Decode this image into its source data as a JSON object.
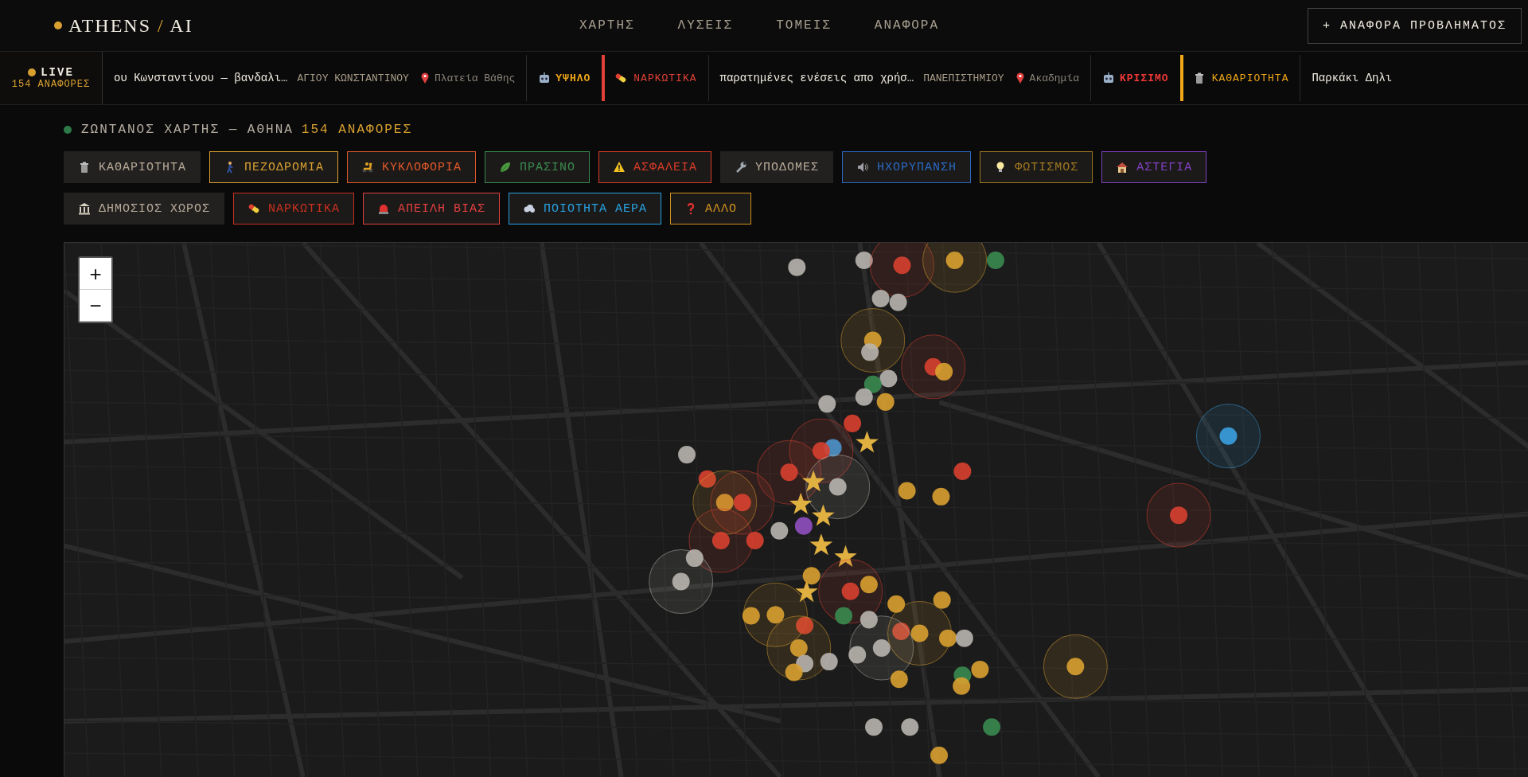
{
  "header": {
    "logo": {
      "name": "ATHENS",
      "separator": "/",
      "suffix": "AI"
    },
    "nav": [
      {
        "label": "ΧΑΡΤΗΣ",
        "selected": false
      },
      {
        "label": "ΛΥΣΕΙΣ",
        "selected": false
      },
      {
        "label": "ΤΟΜΕΙΣ",
        "selected": false
      },
      {
        "label": "ΑΝΑΦΟΡΑ",
        "selected": false
      }
    ],
    "report_button": "+ ΑΝΑΦΟΡΑ ΠΡΟΒΛΗΜΑΤΟΣ"
  },
  "ticker": {
    "live_label": "LIVE",
    "live_count": "154 ΑΝΑΦΟΡΕΣ",
    "items": [
      {
        "title": "ου Κωνσταντίνου — βανδαλι…",
        "street": "ΑΓΙΟΥ ΚΩΝΣΤΑΝΤΙΝΟΥ",
        "place": "Πλατεία Βάθης",
        "priority": {
          "label": "ΥΨΗΛΟ",
          "color": "#f0a818"
        }
      },
      {
        "category": {
          "label": "ΝΑΡΚΩΤΙΚΑ",
          "color": "#e04038"
        },
        "title": "παρατημένες ενέσεις απο χρήσ…",
        "street": "ΠΑΝΕΠΙΣΤΗΜΙΟΥ",
        "place": "Ακαδημία",
        "priority": {
          "label": "ΚΡΙΣΙΜΟ",
          "color": "#f03838"
        }
      },
      {
        "category": {
          "label": "ΚΑΘΑΡΙΟΤΗΤΑ",
          "color": "#f0a818"
        },
        "title": "Παρκάκι Δηλι"
      }
    ]
  },
  "section": {
    "title": "ΖΩΝΤΑΝΟΣ ΧΑΡΤΗΣ — ΑΘΗΝΑ",
    "count": "154 ΑΝΑΦΟΡΕΣ"
  },
  "filters": [
    {
      "label": "ΚΑΘΑΡΙΟΤΗΤΑ",
      "kind": "filled",
      "color": "#b8aa98"
    },
    {
      "label": "ΠΕΖΟΔΡΟΜΙΑ",
      "kind": "outlined",
      "color": "#d9a030"
    },
    {
      "label": "ΚΥΚΛΟΦΟΡΙΑ",
      "kind": "outlined",
      "color": "#e0582a"
    },
    {
      "label": "ΠΡΑΣΙΝΟ",
      "kind": "outlined",
      "color": "#3a8a50"
    },
    {
      "label": "ΑΣΦΑΛΕΙΑ",
      "kind": "outlined",
      "color": "#d83a28"
    },
    {
      "label": "ΥΠΟΔΟΜΕΣ",
      "kind": "filled",
      "color": "#b8aa98"
    },
    {
      "label": "ΗΧΟΡΥΠΑΝΣΗ",
      "kind": "outlined",
      "color": "#2a68c0"
    },
    {
      "label": "ΦΩΤΙΣΜΟΣ",
      "kind": "outlined",
      "color": "#a07820"
    },
    {
      "label": "ΑΣΤΕΓΙΑ",
      "kind": "outlined",
      "color": "#8040c0"
    },
    {
      "label": "ΔΗΜΟΣΙΟΣ ΧΩΡΟΣ",
      "kind": "filled",
      "color": "#b8aa98"
    },
    {
      "label": "ΝΑΡΚΩΤΙΚΑ",
      "kind": "outlined",
      "color": "#c83020"
    },
    {
      "label": "ΑΠΕΙΛΗ ΒΙΑΣ",
      "kind": "outlined",
      "color": "#e04040"
    },
    {
      "label": "ΠΟΙΟΤΗΤΑ ΑΕΡΑ",
      "kind": "outlined",
      "color": "#28a0e0"
    },
    {
      "label": "ΑΛΛΟ",
      "kind": "outlined",
      "color": "#d09020"
    }
  ],
  "map": {
    "zoom_in": "+",
    "zoom_out": "−"
  }
}
